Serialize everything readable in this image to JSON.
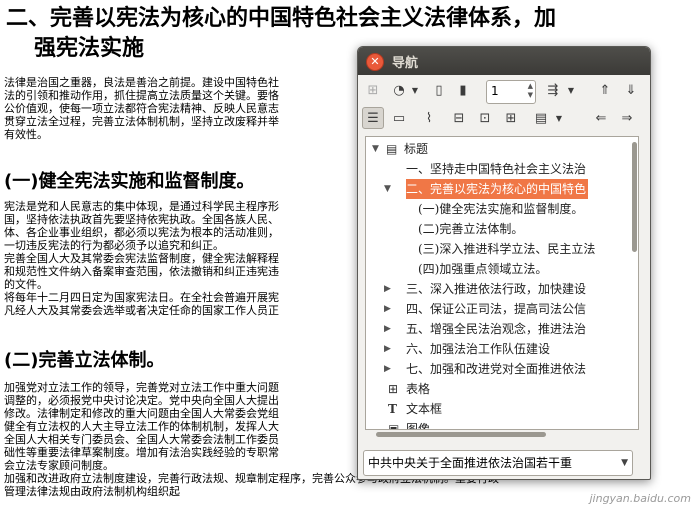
{
  "document": {
    "heading_line1": "二、完善以宪法为核心的中国特色社会主义法律体系，加",
    "heading_line2": "强宪法实施",
    "para1": [
      "法律是治国之重器，良法是善治之前提。建设中国特色社",
      "法的引领和推动作用，抓住提高立法质量这个关键。要恪",
      "公价值观，使每一项立法都符合宪法精神、反映人民意志",
      "贯穿立法全过程，完善立法体制机制，坚持立改废释并举",
      "有效性。"
    ],
    "section1_title": "(一)健全宪法实施和监督制度。",
    "para2": [
      "宪法是党和人民意志的集中体现，是通过科学民主程序形",
      "国，坚持依法执政首先要坚持依宪执政。全国各族人民、",
      "体、各企业事业组织，都必须以宪法为根本的活动准则，",
      "一切违反宪法的行为都必须予以追究和纠正。",
      "完善全国人大及其常委会宪法监督制度，健全宪法解释程",
      "和规范性文件纳入备案审查范围，依法撤销和纠正违宪违",
      "的文件。",
      "将每年十二月四日定为国家宪法日。在全社会普遍开展宪",
      "凡经人大及其常委会选举或者决定任命的国家工作人员正"
    ],
    "section2_title": "(二)完善立法体制。",
    "para3": [
      "加强党对立法工作的领导，完善党对立法工作中重大问题",
      "调整的，必须报党中央讨论决定。党中央向全国人大提出",
      "修改。法律制定和修改的重大问题由全国人大常委会党组",
      "健全有立法权的人大主导立法工作的体制机制，发挥人大",
      "全国人大相关专门委员会、全国人大常委会法制工作委员",
      "础性等重要法律草案制度。增加有法治实践经验的专职常",
      "会立法专家顾问制度。",
      "加强和改进政府立法制度建设，完善行政法规、规章制定程序，完善公众参与政府立法机制。重要行政",
      "管理法律法规由政府法制机构组织起"
    ]
  },
  "navigator": {
    "title": "导航",
    "page_number": "1",
    "tree": {
      "root": "标题",
      "items": [
        "一、坚持走中国特色社会主义法治",
        "二、完善以宪法为核心的中国特色",
        "(一)健全宪法实施和监督制度。",
        "(二)完善立法体制。",
        "(三)深入推进科学立法、民主立法",
        "(四)加强重点领域立法。",
        "三、深入推进依法行政，加快建设",
        "四、保证公正司法，提高司法公信",
        "五、增强全民法治观念，推进法治",
        "六、加强法治工作队伍建设",
        "七、加强和改进党对全面推进依法"
      ],
      "tables": "表格",
      "frames": "文本框",
      "images": "图像"
    },
    "document_combo": "中共中央关于全面推进依法治国若干重"
  },
  "watermark": "jingyan.baidu.com",
  "colors": {
    "selection": "#f07746",
    "close_button": "#e9593a",
    "titlebar": "#3b3a37"
  }
}
